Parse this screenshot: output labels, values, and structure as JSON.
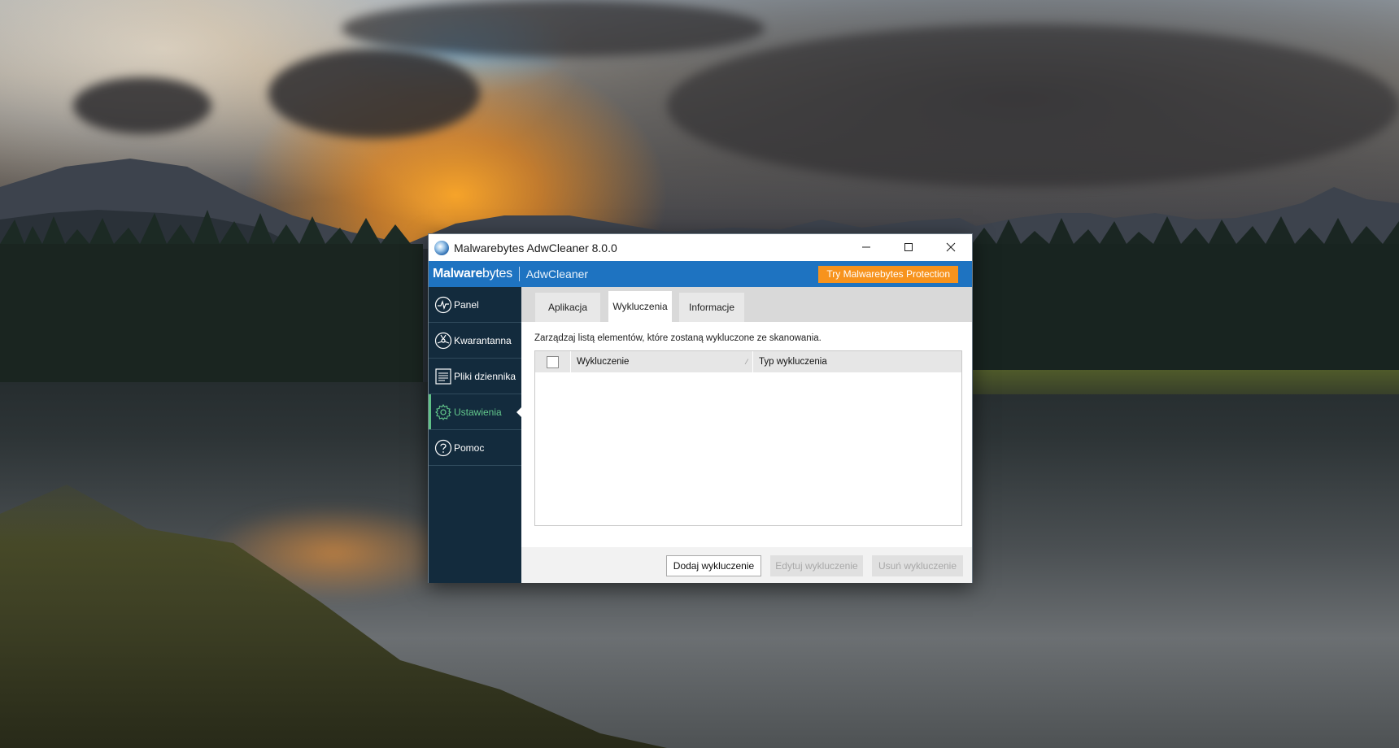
{
  "window": {
    "title": "Malwarebytes AdwCleaner 8.0.0",
    "controls": {
      "minimize": "—",
      "maximize": "☐",
      "close": "✕"
    }
  },
  "brand": {
    "logo_bold": "Malware",
    "logo_rest": "bytes",
    "product": "AdwCleaner",
    "try_button": "Try Malwarebytes Protection",
    "bar_color": "#1e73c1",
    "try_color": "#f7931d"
  },
  "sidebar": {
    "items": [
      {
        "label": "Panel",
        "icon": "pulse-icon",
        "active": false
      },
      {
        "label": "Kwarantanna",
        "icon": "biohazard-icon",
        "active": false
      },
      {
        "label": "Pliki dziennika",
        "icon": "document-icon",
        "active": false
      },
      {
        "label": "Ustawienia",
        "icon": "gear-icon",
        "active": true
      },
      {
        "label": "Pomoc",
        "icon": "help-icon",
        "active": false
      }
    ],
    "active_color": "#5fc287"
  },
  "tabs": [
    {
      "label": "Aplikacja",
      "active": false
    },
    {
      "label": "Wykluczenia",
      "active": true
    },
    {
      "label": "Informacje",
      "active": false
    }
  ],
  "exclusions": {
    "description": "Zarządzaj listą elementów, które zostaną wykluczone ze skanowania.",
    "columns": [
      "Wykluczenie",
      "Typ wykluczenia"
    ],
    "rows": []
  },
  "footer": {
    "add_button": "Dodaj wykluczenie",
    "edit_button": "Edytuj wykluczenie",
    "remove_button": "Usuń wykluczenie"
  }
}
